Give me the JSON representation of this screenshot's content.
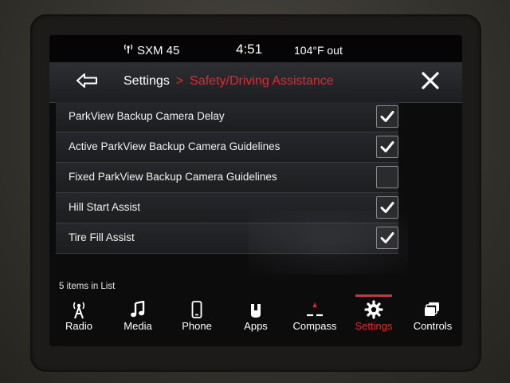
{
  "status": {
    "radio": "SXM 45",
    "time": "4:51",
    "temp": "104°F out"
  },
  "header": {
    "breadcrumb_parent": "Settings",
    "breadcrumb_sep": ">",
    "breadcrumb_current": "Safety/Driving Assistance"
  },
  "list": {
    "items": [
      {
        "label": "ParkView Backup Camera Delay",
        "checked": true
      },
      {
        "label": "Active ParkView Backup Camera Guidelines",
        "checked": true
      },
      {
        "label": "Fixed ParkView Backup Camera Guidelines",
        "checked": false
      },
      {
        "label": "Hill Start Assist",
        "checked": true
      },
      {
        "label": "Tire Fill Assist",
        "checked": true
      }
    ],
    "count_text": "5 items in List"
  },
  "nav": {
    "items": [
      {
        "label": "Radio",
        "icon": "radio-antenna-icon"
      },
      {
        "label": "Media",
        "icon": "music-note-icon"
      },
      {
        "label": "Phone",
        "icon": "phone-icon"
      },
      {
        "label": "Apps",
        "icon": "apps-icon"
      },
      {
        "label": "Compass",
        "icon": "compass-icon"
      },
      {
        "label": "Settings",
        "icon": "gear-icon",
        "active": true
      },
      {
        "label": "Controls",
        "icon": "controls-icon"
      }
    ]
  },
  "colors": {
    "accent": "#e8262b",
    "background": "#0c0c0d"
  }
}
